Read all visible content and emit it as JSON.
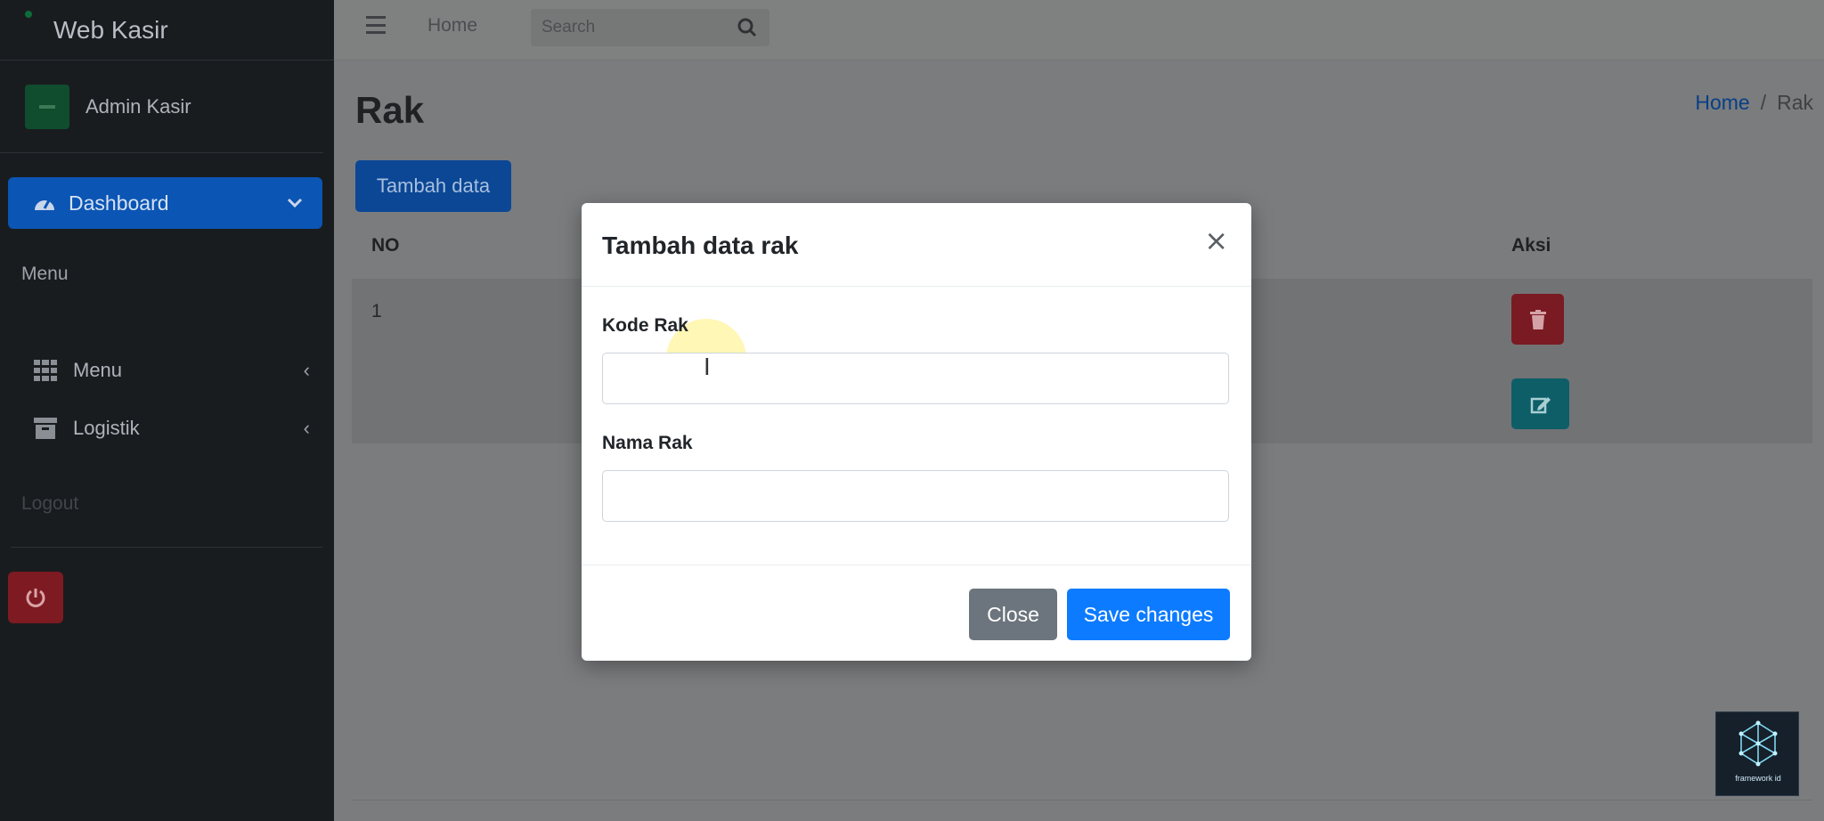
{
  "app": {
    "brand": "Web Kasir",
    "user": "Admin Kasir"
  },
  "sidebar": {
    "active_item": "Dashboard",
    "header": "Menu",
    "items": [
      {
        "label": "Menu",
        "icon": "grid-icon"
      },
      {
        "label": "Logistik",
        "icon": "archive-icon"
      }
    ],
    "logout": "Logout"
  },
  "topbar": {
    "home": "Home",
    "search_placeholder": "Search"
  },
  "page": {
    "title": "Rak",
    "breadcrumb": [
      "Home",
      "/",
      "Rak"
    ],
    "add_button": "Tambah data",
    "table": {
      "headers": {
        "no": "NO",
        "aksi": "Aksi"
      },
      "rows": [
        {
          "no": "1"
        }
      ]
    }
  },
  "modal": {
    "title": "Tambah data rak",
    "close_symbol": "×",
    "fields": [
      {
        "label": "Kode Rak",
        "value": ""
      },
      {
        "label": "Nama Rak",
        "value": ""
      }
    ],
    "close_button": "Close",
    "save_button": "Save changes"
  },
  "watermark": "framework id",
  "colors": {
    "primary": "#0d7bff",
    "secondary": "#6c757d",
    "danger": "#dc3545",
    "info": "#17a2b8",
    "sidebar": "#191c1f"
  }
}
